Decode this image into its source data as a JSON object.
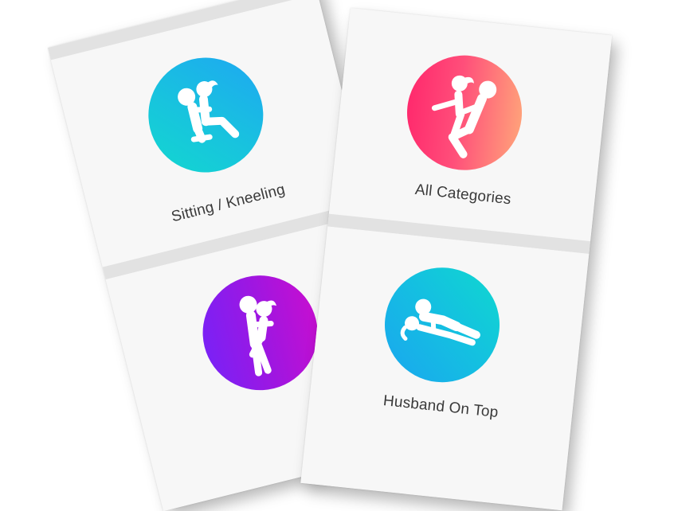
{
  "categories": [
    {
      "label": "Sitting / Kneeling",
      "icon": "sitting-kneeling-icon",
      "gradient": [
        "#12d8cf",
        "#1ea7f2"
      ]
    },
    {
      "label": "",
      "icon": "standing-icon",
      "gradient": [
        "#7b21f5",
        "#c40fd1"
      ]
    },
    {
      "label": "All Categories",
      "icon": "all-categories-icon",
      "gradient": [
        "#ff2a6d",
        "#ffa07a"
      ]
    },
    {
      "label": "Husband On Top",
      "icon": "husband-on-top-icon",
      "gradient": [
        "#1aa6ef",
        "#0fd8cf"
      ]
    }
  ]
}
